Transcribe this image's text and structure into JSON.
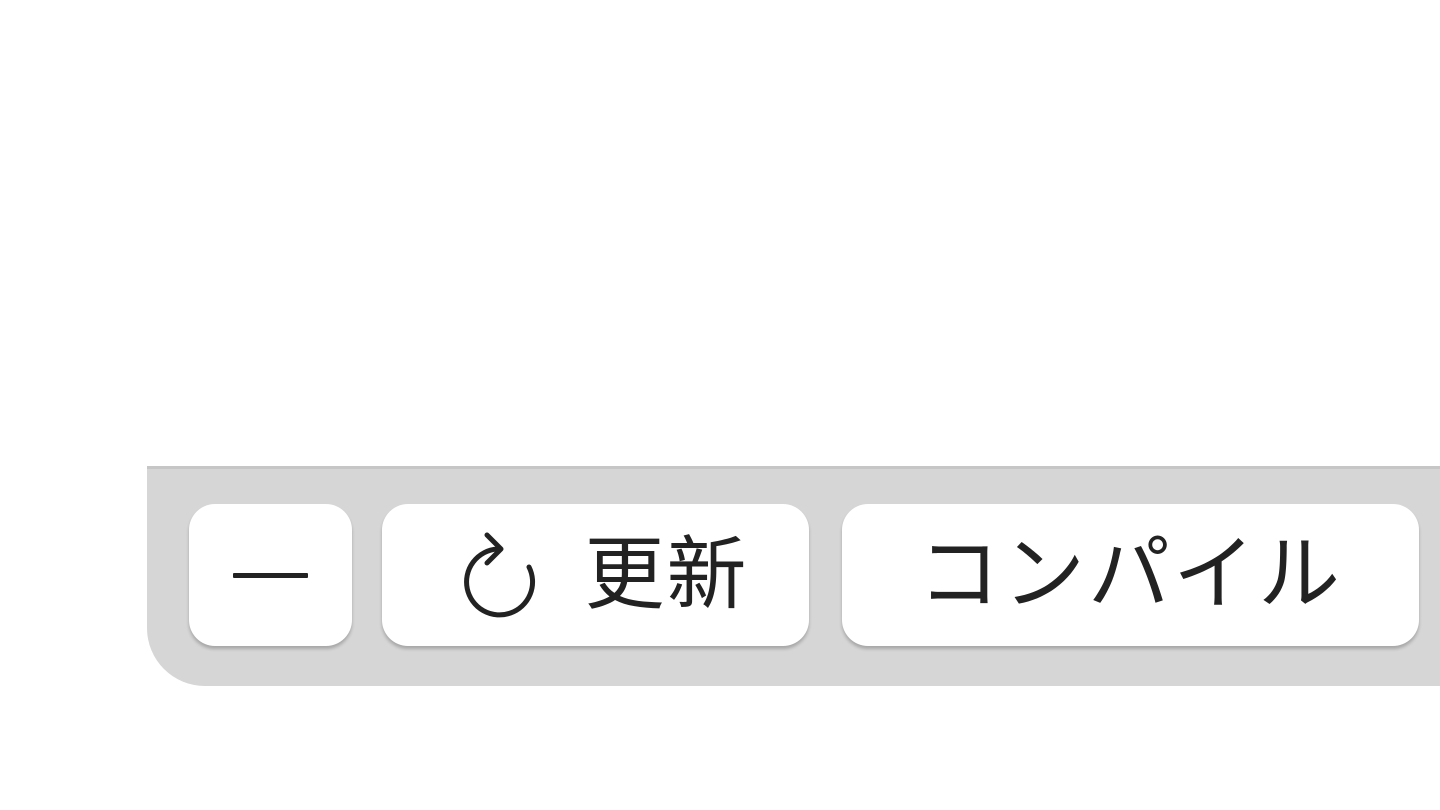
{
  "toolbar": {
    "minus_label": "ー",
    "refresh_label": "更新",
    "refresh_icon": "refresh-icon",
    "compile_label": "コンパイル"
  },
  "colors": {
    "toolbar_bg": "#d6d6d6",
    "button_bg": "#ffffff",
    "text": "#222222"
  }
}
